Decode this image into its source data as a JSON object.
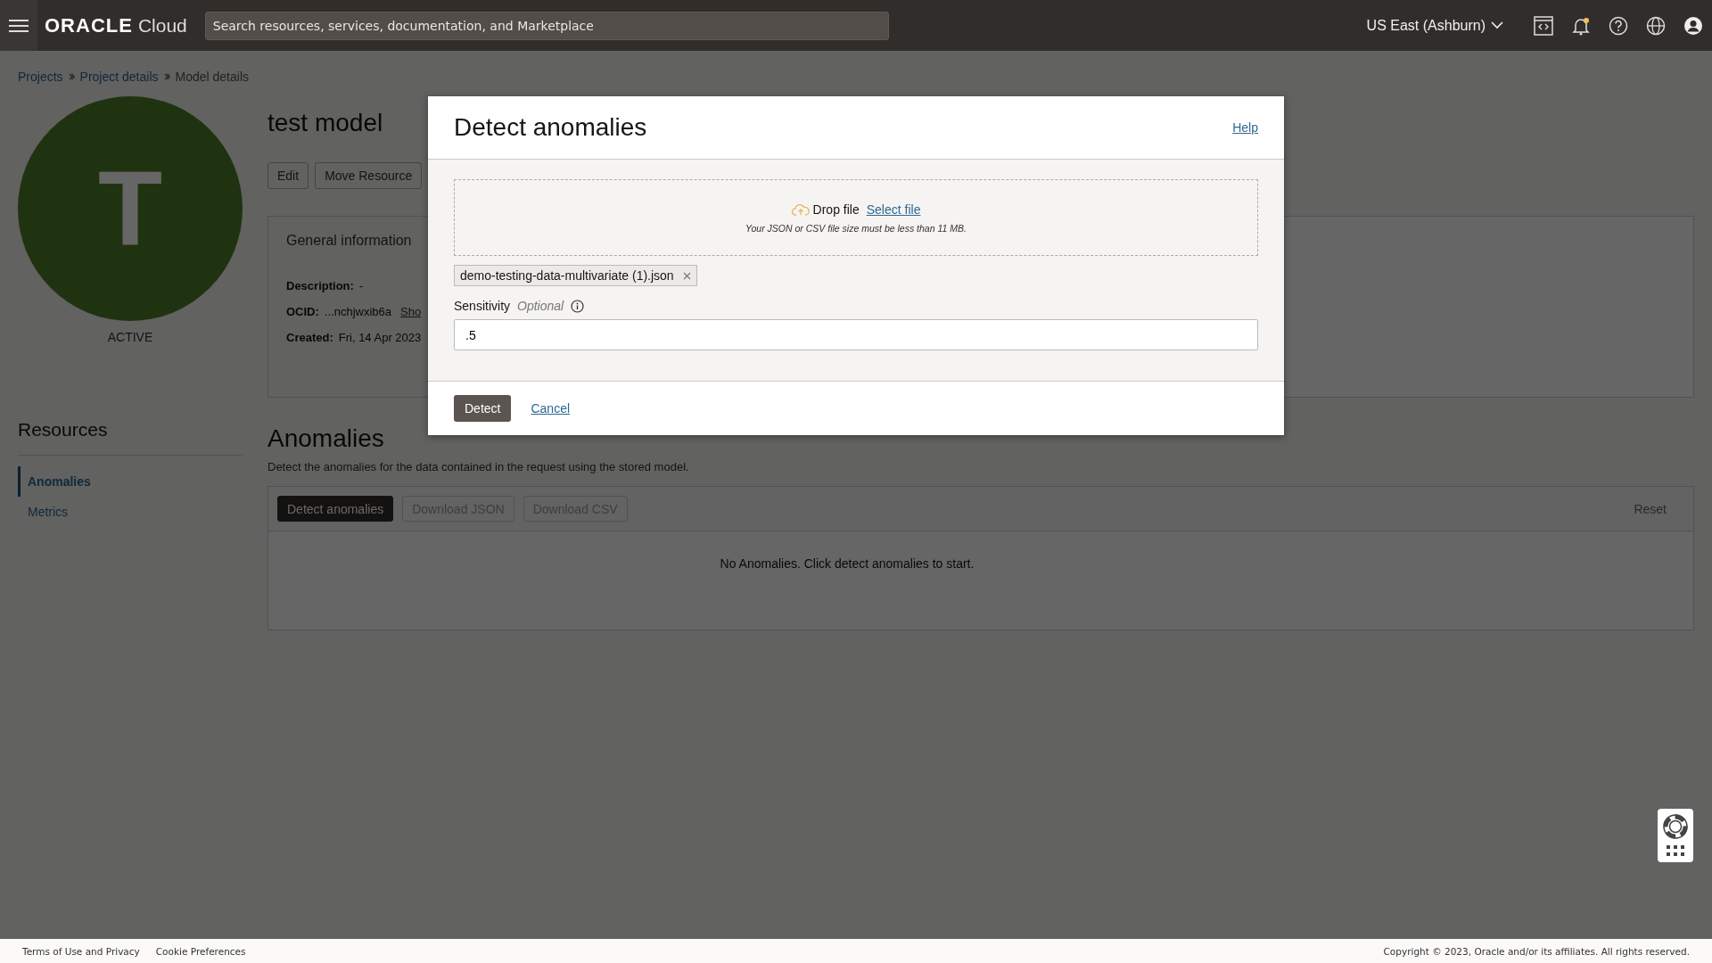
{
  "header": {
    "brand": "ORACLE",
    "brand_suffix": "Cloud",
    "search": {
      "placeholder": "Search resources, services, documentation, and Marketplace"
    },
    "region": "US East (Ashburn)"
  },
  "breadcrumbs": [
    {
      "label": "Projects",
      "kind": "link"
    },
    {
      "label": "Project details",
      "kind": "link"
    },
    {
      "label": "Model details",
      "kind": "current"
    }
  ],
  "resource": {
    "initial": "T",
    "status": "ACTIVE",
    "title": "test model",
    "actions": [
      "Edit",
      "Move Resource"
    ]
  },
  "general_information": {
    "tab": "General information",
    "fields": [
      {
        "label": "Description:",
        "value": "-"
      },
      {
        "label": "OCID:",
        "value": "...nchjwxib6a",
        "link": "Sho"
      },
      {
        "label": "Created:",
        "value": "Fri, 14 Apr 2023"
      }
    ]
  },
  "resources_nav": {
    "title": "Resources",
    "items": [
      {
        "label": "Anomalies",
        "selected": true
      },
      {
        "label": "Metrics",
        "selected": false
      }
    ]
  },
  "anomalies": {
    "title": "Anomalies",
    "description": "Detect the anomalies for the data contained in the request using the stored model.",
    "buttons": [
      {
        "label": "Detect anomalies",
        "disabled": false
      },
      {
        "label": "Download JSON",
        "disabled": true
      },
      {
        "label": "Download CSV",
        "disabled": true
      }
    ],
    "reset": "Reset",
    "empty_message": "No Anomalies. Click detect anomalies to start."
  },
  "dialog": {
    "title": "Detect anomalies",
    "help": "Help",
    "drop_label": "Drop file",
    "select_file": "Select file",
    "hint": "Your JSON or CSV file size must be less than 11 MB.",
    "file_chip": "demo-testing-data-multivariate (1).json",
    "sensitivity_label": "Sensitivity",
    "optional": "Optional",
    "sensitivity_value": ".5",
    "primary": "Detect",
    "cancel": "Cancel"
  },
  "footer": {
    "links": [
      "Terms of Use and Privacy",
      "Cookie Preferences"
    ],
    "copyright": "Copyright © 2023, Oracle and/or its affiliates. All rights reserved."
  }
}
